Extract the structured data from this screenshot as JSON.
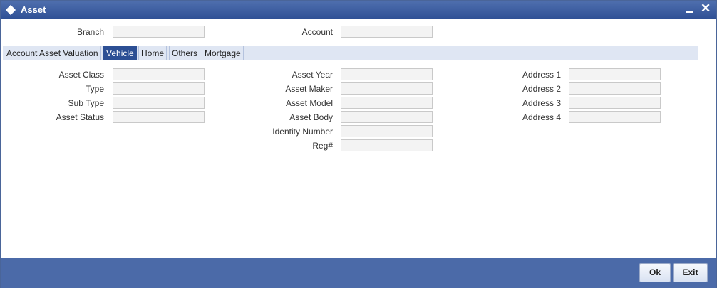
{
  "window": {
    "title": "Asset"
  },
  "header": {
    "branch": {
      "label": "Branch",
      "value": ""
    },
    "account": {
      "label": "Account",
      "value": ""
    }
  },
  "tabs": [
    {
      "label": "Account Asset Valuation"
    },
    {
      "label": "Vehicle"
    },
    {
      "label": "Home"
    },
    {
      "label": "Others"
    },
    {
      "label": "Mortgage"
    }
  ],
  "active_tab": "Vehicle",
  "vehicle": {
    "asset_class": {
      "label": "Asset Class",
      "value": ""
    },
    "type": {
      "label": "Type",
      "value": ""
    },
    "sub_type": {
      "label": "Sub Type",
      "value": ""
    },
    "asset_status": {
      "label": "Asset Status",
      "value": ""
    },
    "asset_year": {
      "label": "Asset Year",
      "value": ""
    },
    "asset_maker": {
      "label": "Asset Maker",
      "value": ""
    },
    "asset_model": {
      "label": "Asset Model",
      "value": ""
    },
    "asset_body": {
      "label": "Asset Body",
      "value": ""
    },
    "identity_number": {
      "label": "Identity Number",
      "value": ""
    },
    "reg": {
      "label": "Reg#",
      "value": ""
    },
    "address_1": {
      "label": "Address 1",
      "value": ""
    },
    "address_2": {
      "label": "Address 2",
      "value": ""
    },
    "address_3": {
      "label": "Address 3",
      "value": ""
    },
    "address_4": {
      "label": "Address 4",
      "value": ""
    }
  },
  "footer": {
    "ok_label": "Ok",
    "exit_label": "Exit"
  },
  "icons": {
    "title": "diamond-icon",
    "minimize": "minimize-icon",
    "close": "close-icon"
  },
  "colors": {
    "titlebar": "#2f5095",
    "active_tab": "#2c4f94",
    "footer": "#4b6aa8"
  }
}
